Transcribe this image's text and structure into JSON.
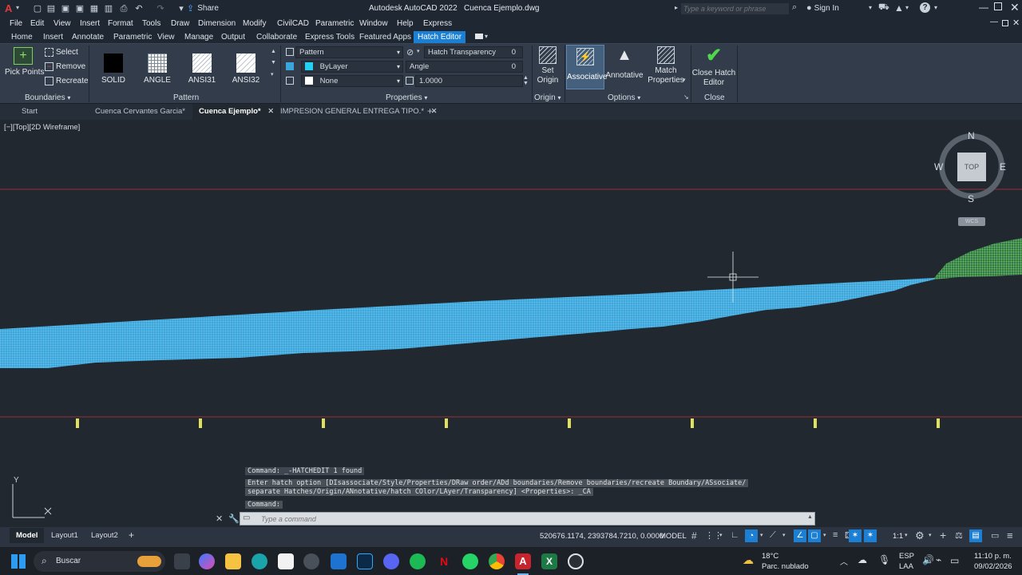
{
  "app": {
    "title": "Autodesk AutoCAD 2022",
    "file": "Cuenca Ejemplo.dwg",
    "share": "Share",
    "search_placeholder": "Type a keyword or phrase",
    "sign_in": "Sign In"
  },
  "menu": [
    "File",
    "Edit",
    "View",
    "Insert",
    "Format",
    "Tools",
    "Draw",
    "Dimension",
    "Modify",
    "CivilCAD",
    "Parametric",
    "Window",
    "Help",
    "Express"
  ],
  "ribbon_tabs": [
    "Home",
    "Insert",
    "Annotate",
    "Parametric",
    "View",
    "Manage",
    "Output",
    "Collaborate",
    "Express Tools",
    "Featured Apps",
    "Hatch Editor"
  ],
  "ribbon": {
    "boundaries": {
      "pick_points": "Pick Points",
      "select": "Select",
      "remove": "Remove",
      "recreate": "Recreate",
      "label": "Boundaries"
    },
    "pattern": {
      "items": [
        "SOLID",
        "ANGLE",
        "ANSI31",
        "ANSI32"
      ],
      "label": "Pattern"
    },
    "properties": {
      "type": "Pattern",
      "color": "ByLayer",
      "background": "None",
      "transparency_label": "Hatch Transparency",
      "transparency_value": "0",
      "angle_label": "Angle",
      "angle_value": "0",
      "scale_value": "1.0000",
      "label": "Properties"
    },
    "origin": {
      "set_origin": "Set Origin",
      "label": "Origin"
    },
    "options": {
      "associative": "Associative",
      "annotative": "Annotative",
      "match_properties": "Match Properties",
      "label": "Options"
    },
    "close": {
      "close_hatch_editor": "Close Hatch Editor",
      "label": "Close"
    }
  },
  "doc_tabs": [
    "Start",
    "Cuenca Cervantes Garcia*",
    "Cuenca Ejemplo*",
    "IMPRESION GENERAL ENTREGA TIPO.*"
  ],
  "viewport": {
    "label": "[−][Top][2D Wireframe]",
    "compass": {
      "n": "N",
      "s": "S",
      "e": "E",
      "w": "W",
      "top": "TOP",
      "wcs": "WCS"
    },
    "ucs_y": "Y"
  },
  "command": {
    "line1": "Command: _-HATCHEDIT 1 found",
    "line2": "Enter hatch option [DIsassociate/Style/Properties/DRaw order/ADd boundaries/Remove boundaries/recreate Boundary/ASsociate/",
    "line3": "separate Hatches/Origin/ANnotative/hatch COlor/LAyer/Transparency] <Properties>: _CA",
    "line4": "Command:",
    "placeholder": "Type a command"
  },
  "layout_tabs": [
    "Model",
    "Layout1",
    "Layout2"
  ],
  "status": {
    "coords": "520676.1174, 2393784.7210, 0.0000",
    "model": "MODEL",
    "scale": "1:1"
  },
  "taskbar": {
    "search": "Buscar",
    "weather_temp": "18°C",
    "weather_desc": "Parc. nublado",
    "lang": "ESP",
    "lang2": "LAA",
    "time": "11:10 p. m.",
    "date": "09/02/2026"
  },
  "colors": {
    "hatch_blue": "#3aa7dc",
    "hatch_green": "#93d84a",
    "accent": "#1b7fd3",
    "red_line": "#c0303a"
  }
}
